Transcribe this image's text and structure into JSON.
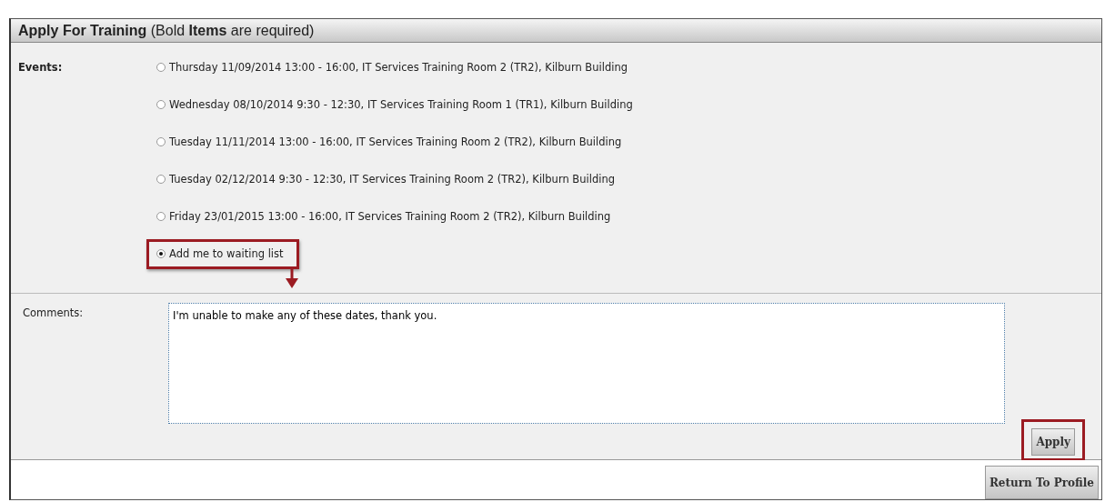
{
  "form": {
    "title": "**Apply For Training** (Bold **Items** are required)",
    "events_label": "Events:",
    "events": [
      {
        "label": "Thursday 11/09/2014 13:00 - 16:00, IT Services Training Room 2 (TR2), Kilburn Building",
        "selected": false,
        "highlighted": false
      },
      {
        "label": "Wednesday 08/10/2014 9:30 - 12:30, IT Services Training Room 1 (TR1), Kilburn Building",
        "selected": false,
        "highlighted": false
      },
      {
        "label": "Tuesday 11/11/2014 13:00 - 16:00, IT Services Training Room 2 (TR2), Kilburn Building",
        "selected": false,
        "highlighted": false
      },
      {
        "label": "Tuesday 02/12/2014 9:30 - 12:30, IT Services Training Room 2 (TR2), Kilburn Building",
        "selected": false,
        "highlighted": false
      },
      {
        "label": "Friday 23/01/2015 13:00 - 16:00, IT Services Training Room 2 (TR2), Kilburn Building",
        "selected": false,
        "highlighted": false
      },
      {
        "label": "Add me to waiting list",
        "selected": true,
        "highlighted": true
      }
    ],
    "comments_label": "Comments:",
    "comments_value": "I'm unable to make any of these dates, thank you.",
    "apply_button": {
      "label": "Apply",
      "highlighted": true
    },
    "return_button": "Return To Profile"
  }
}
